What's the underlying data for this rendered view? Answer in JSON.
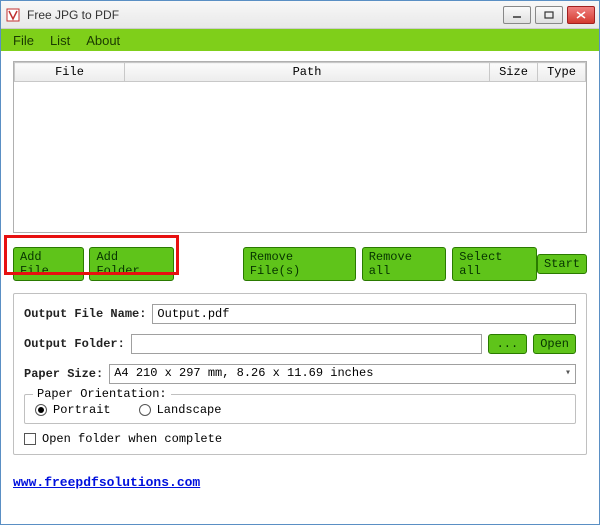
{
  "window": {
    "title": "Free JPG to PDF"
  },
  "menubar": {
    "file": "File",
    "list": "List",
    "about": "About"
  },
  "table": {
    "headers": {
      "file": "File",
      "path": "Path",
      "size": "Size",
      "type": "Type"
    }
  },
  "buttons": {
    "add_file": "Add File",
    "add_folder": "Add Folder",
    "remove_files": "Remove File(s)",
    "remove_all": "Remove all",
    "select_all": "Select all",
    "start": "Start",
    "browse": "...",
    "open": "Open"
  },
  "settings": {
    "output_file_label": "Output File Name:",
    "output_file_value": "Output.pdf",
    "output_folder_label": "Output Folder:",
    "output_folder_value": "",
    "paper_size_label": "Paper Size:",
    "paper_size_value": "A4 210 x 297 mm, 8.26 x 11.69 inches",
    "orientation_legend": "Paper Orientation:",
    "portrait": "Portrait",
    "landscape": "Landscape",
    "open_when_complete": "Open folder when complete"
  },
  "link": "www.freepdfsolutions.com"
}
